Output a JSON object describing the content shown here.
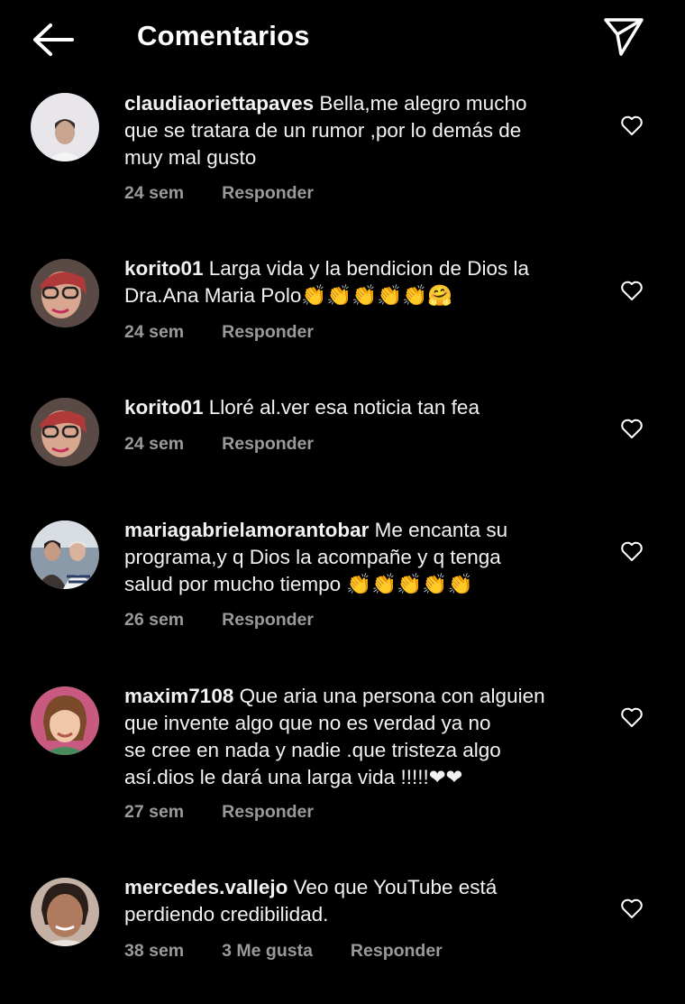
{
  "header": {
    "title": "Comentarios",
    "icons": {
      "back": "arrow-left-icon",
      "send": "paper-plane-icon"
    }
  },
  "colors": {
    "background": "#000000",
    "text": "#ffffff",
    "meta": "#9a9a9a",
    "heart": "#e8213d"
  },
  "comments": [
    {
      "user": "claudiaoriettapaves",
      "text": " Bella,me alegro mucho\nque se tratara de un rumor ,por lo demás de\nmuy mal gusto",
      "time": "24 sem",
      "reply": "Responder"
    },
    {
      "user": "korito01",
      "text": " Larga vida y la bendicion de Dios  la\nDra.Ana Maria Polo👏👏👏👏👏🤗",
      "time": "24 sem",
      "reply": "Responder"
    },
    {
      "user": "korito01",
      "text": " Lloré al.ver esa noticia tan fea",
      "time": "24 sem",
      "reply": "Responder"
    },
    {
      "user": "mariagabrielamorantobar",
      "text": " Me encanta su\nprograma,y q Dios la acompañe y q tenga\nsalud por mucho tiempo 👏👏👏👏👏",
      "time": "26 sem",
      "reply": "Responder"
    },
    {
      "user": "maxim7108",
      "text": " Que aria una persona con alguien\nque invente algo que no es verdad ya no\nse cree en nada y nadie .que tristeza algo\nasí.dios le dará una larga vida !!!!!❤❤",
      "time": "27 sem",
      "reply": "Responder"
    },
    {
      "user": "mercedes.vallejo",
      "text": " Veo que YouTube está\nperdiendo credibilidad.",
      "time": "38 sem",
      "likes": "3 Me gusta",
      "reply": "Responder"
    }
  ]
}
